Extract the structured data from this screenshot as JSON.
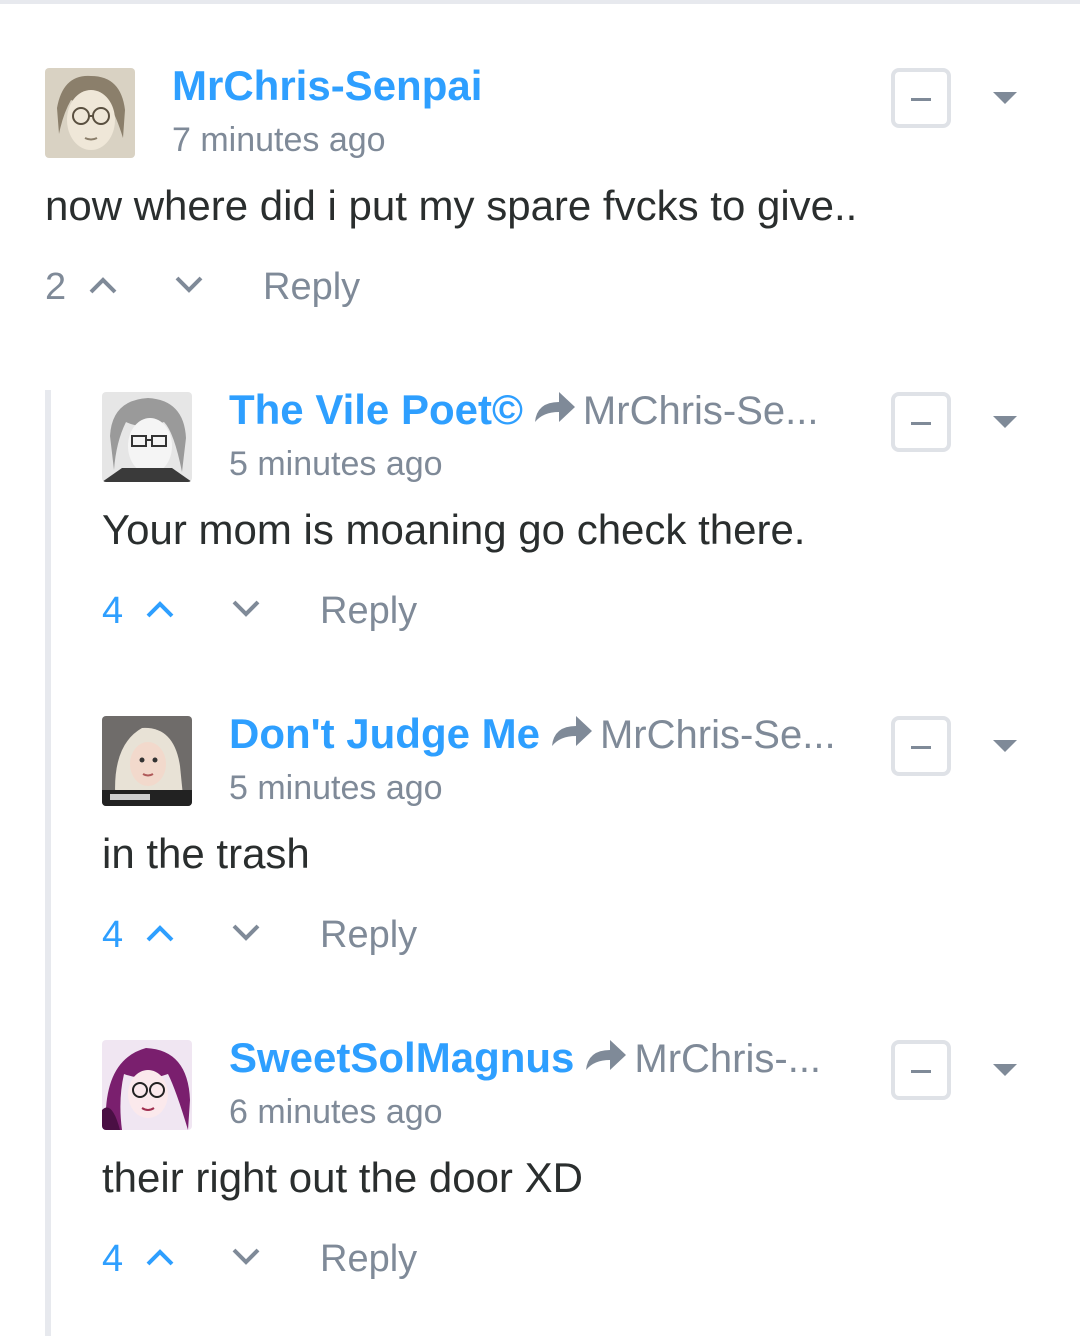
{
  "comments": [
    {
      "author": "MrChris-Senpai",
      "reply_to": "",
      "time": "7 minutes ago",
      "text": "now where did i put my spare fvcks to give..",
      "votes": "2",
      "reply_label": "Reply",
      "avatar_icon": "anime-avatar-glasses-sepia"
    },
    {
      "author": "The Vile Poet©",
      "reply_to": "MrChris-Se...",
      "time": "5 minutes ago",
      "text": "Your mom is moaning go check there.",
      "votes": "4",
      "reply_label": "Reply",
      "avatar_icon": "anime-avatar-glasses-grey"
    },
    {
      "author": "Don't Judge Me",
      "reply_to": "MrChris-Se...",
      "time": "5 minutes ago",
      "text": "in the trash",
      "votes": "4",
      "reply_label": "Reply",
      "avatar_icon": "photo-avatar-blonde"
    },
    {
      "author": "SweetSolMagnus",
      "reply_to": "MrChris-...",
      "time": "6 minutes ago",
      "text": "their right out the door XD",
      "votes": "4",
      "reply_label": "Reply",
      "avatar_icon": "anime-avatar-purple"
    }
  ],
  "colors": {
    "author_blue": "#2e9fff",
    "meta_grey": "#7f8a98",
    "text_dark": "#2a2e2e",
    "border_light": "#dfe2e7"
  }
}
